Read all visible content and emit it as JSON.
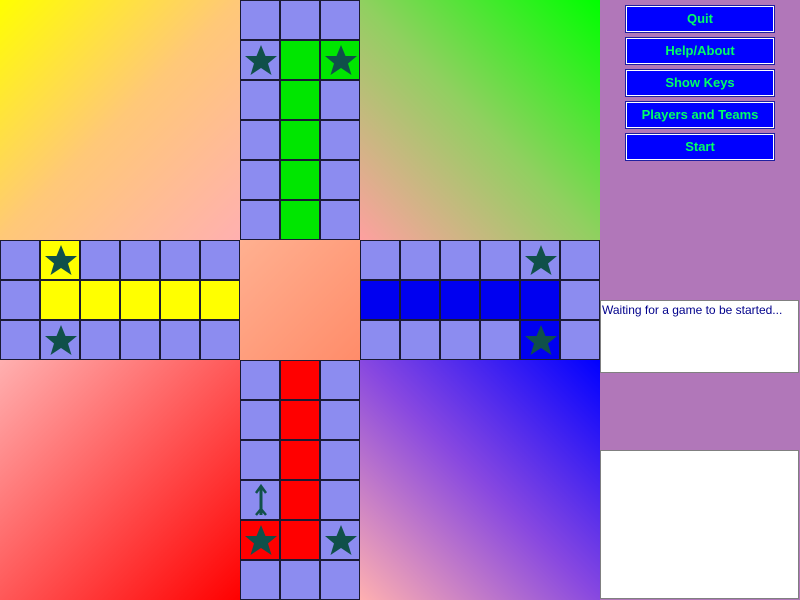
{
  "colors": {
    "track": "#8c8cf0",
    "green": "#00e600",
    "yellow": "#ffff00",
    "blue": "#0000f0",
    "red": "#ff0000",
    "star": "#10504a",
    "panel": "#b177b9",
    "button_bg": "#0000ff",
    "button_text": "#00ff66"
  },
  "menu": {
    "buttons": [
      {
        "id": "quit",
        "label": "Quit"
      },
      {
        "id": "help-about",
        "label": "Help/About"
      },
      {
        "id": "show-keys",
        "label": "Show Keys"
      },
      {
        "id": "players-teams",
        "label": "Players and Teams"
      },
      {
        "id": "start",
        "label": "Start"
      }
    ]
  },
  "status": {
    "message": "Waiting for a game to be started..."
  },
  "chat": {
    "text": ""
  }
}
